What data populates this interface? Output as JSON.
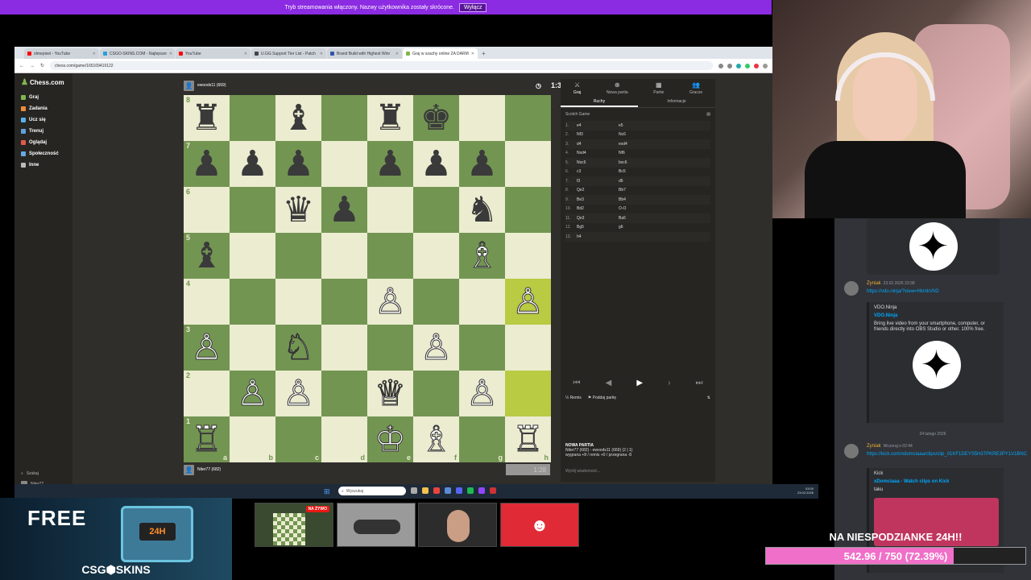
{
  "banner": {
    "text": "Tryb streamowania włączony. Nazwy użytkownika zostały skrócone.",
    "button": "Wyłącz"
  },
  "browser": {
    "tabs": [
      {
        "label": "olmepixel - YouTube",
        "color": "#ff0000"
      },
      {
        "label": "CSGO-SKINS.COM - Najlepsze",
        "color": "#2a9fd6"
      },
      {
        "label": "YouTube",
        "color": "#ff0000"
      },
      {
        "label": "U.GG Support Tier List - Patch",
        "color": "#444"
      },
      {
        "label": "Brand Build with Highest Winr",
        "color": "#3355aa"
      },
      {
        "label": "Graj w szachy online ZA DARM",
        "color": "#81b64c"
      }
    ],
    "new_tab": "+",
    "url": "chess.com/game/165109410122"
  },
  "sidebar": {
    "logo": "Chess.com",
    "items": [
      {
        "label": "Graj",
        "color": "#81b64c"
      },
      {
        "label": "Zadania",
        "color": "#f08c3a"
      },
      {
        "label": "Ucz się",
        "color": "#5ab0e8"
      },
      {
        "label": "Trenuj",
        "color": "#61a0dc"
      },
      {
        "label": "Oglądaj",
        "color": "#e05a4a"
      },
      {
        "label": "Społeczność",
        "color": "#6aa7e0"
      },
      {
        "label": "Inne",
        "color": "#bbbbbb"
      }
    ],
    "search": "Szukaj",
    "user": "Niter77"
  },
  "top_player": {
    "name": "ewoods11 (669)",
    "clock": "1:32"
  },
  "bottom_player": {
    "name": "Niter77 (682)",
    "clock": "1:28"
  },
  "board": [
    [
      "♜",
      "",
      "♝",
      "",
      "♜",
      "♚",
      "",
      ""
    ],
    [
      "♟",
      "♟",
      "♟",
      "",
      "♟",
      "♟",
      "♟",
      ""
    ],
    [
      "",
      "",
      "♛",
      "♟",
      "",
      "",
      "♞",
      ""
    ],
    [
      "♝",
      "",
      "",
      "",
      "",
      "",
      "♗",
      ""
    ],
    [
      "",
      "",
      "",
      "",
      "♙",
      "",
      "",
      "♙"
    ],
    [
      "♙",
      "",
      "♘",
      "",
      "",
      "♙",
      "",
      ""
    ],
    [
      "",
      "♙",
      "♙",
      "",
      "♕",
      "",
      "♙",
      ""
    ],
    [
      "♖",
      "",
      "",
      "",
      "♔",
      "♗",
      "",
      "♖"
    ]
  ],
  "board_colors": [
    "b",
    "b",
    "b",
    "",
    "b",
    "b",
    "",
    ""
  ],
  "panel": {
    "tabs": [
      "Graj",
      "Nowa partia",
      "Partie",
      "Gracze"
    ],
    "subtabs": [
      "Ruchy",
      "Informacje"
    ],
    "opening": "Scotch Game",
    "moves": [
      {
        "n": "1.",
        "w": "e4",
        "b": "e5"
      },
      {
        "n": "2.",
        "w": "Nf3",
        "b": "Nc6"
      },
      {
        "n": "3.",
        "w": "d4",
        "b": "exd4"
      },
      {
        "n": "4.",
        "w": "Nxd4",
        "b": "Nf6"
      },
      {
        "n": "5.",
        "w": "Nxc6",
        "b": "bxc6"
      },
      {
        "n": "6.",
        "w": "c3",
        "b": "Bc5"
      },
      {
        "n": "7.",
        "w": "f3",
        "b": "d6"
      },
      {
        "n": "8.",
        "w": "Qe2",
        "b": "Bb7"
      },
      {
        "n": "9.",
        "w": "Be3",
        "b": "Bb4"
      },
      {
        "n": "10.",
        "w": "Bd2",
        "b": "O-O"
      },
      {
        "n": "11.",
        "w": "Qe3",
        "b": "Ba5"
      },
      {
        "n": "12.",
        "w": "Bg5",
        "b": "g6"
      },
      {
        "n": "13.",
        "w": "h4",
        "b": ""
      }
    ],
    "remis": "Remis",
    "resign": "Poddaj partię",
    "new_game_title": "NOWA PARTIA",
    "new_game_line1": "Niter77 (682) - ewoods11 (669) (2 | 1)",
    "new_game_line2": "wygrana +8 / remis +0 / przegrana -8",
    "message_placeholder": "Wyślij wiadomość..."
  },
  "taskbar": {
    "search": "Wyszukaj",
    "time": "03:00",
    "date": "23.02.2026"
  },
  "discord": {
    "post1": {
      "user": "Zyniak",
      "time": "23.02.2026 23:38",
      "link": "https://vdo.ninja/?view=HkmkVhD",
      "site": "VDO.Ninja",
      "title": "VDO.Ninja",
      "desc": "Bring live video from your smartphone, computer, or friends directly into OBS Studio or other. 100% free."
    },
    "date_sep": "24 lutego 2026",
    "post2": {
      "user": "Zyniak",
      "time": "Wczoraj o 02:44",
      "link": "https://kick.com/xdomciaaa/clips/clip_01KF1DEYS5H37PKRE3PY1V1BNC",
      "site": "Kick",
      "title": "xDomciaaa - Watch clips on Kick",
      "desc": "taku"
    }
  },
  "goal": {
    "title": "NA NIESPODZIANKE 24H!!",
    "value": "542.96 / 750 (72.39%)",
    "fraction": 0.7239
  },
  "ad": {
    "free": "FREE",
    "box_label": "24H",
    "brand": "CSG⬢SKINS"
  },
  "live_badge": "NA ŻYWO"
}
